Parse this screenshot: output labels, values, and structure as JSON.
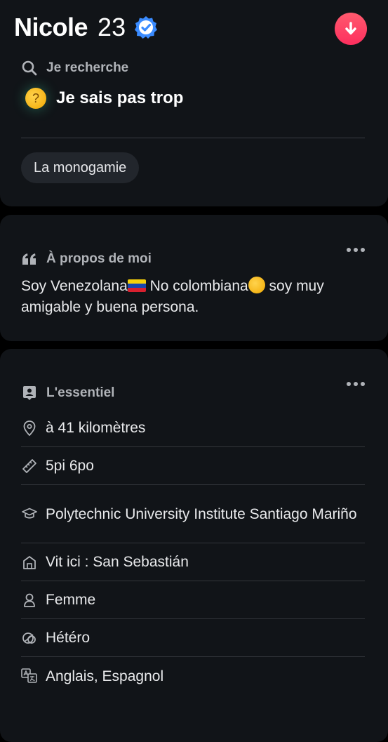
{
  "profile": {
    "name": "Nicole",
    "age": "23",
    "verified": true,
    "accent_color": "#3a8bff",
    "action_color": "#fd3a64"
  },
  "seeking": {
    "heading": "Je recherche",
    "emoji": "🤔",
    "value": "Je sais pas trop",
    "chip": "La monogamie"
  },
  "about": {
    "heading": "À propos de moi",
    "text_part1": "Soy Venezolana",
    "text_part2": " No colombiana",
    "text_part3": " soy muy amigable y buena persona."
  },
  "essentials": {
    "heading": "L'essentiel",
    "items": [
      {
        "icon": "location-pin-icon",
        "label": "à 41 kilomètres"
      },
      {
        "icon": "ruler-icon",
        "label": "5pi 6po"
      },
      {
        "icon": "graduation-cap-icon",
        "label": "Polytechnic University Institute Santiago Mariño"
      },
      {
        "icon": "home-icon",
        "label": "Vit ici : San Sebastián"
      },
      {
        "icon": "person-icon",
        "label": "Femme"
      },
      {
        "icon": "orientation-icon",
        "label": "Hétéro"
      },
      {
        "icon": "translate-icon",
        "label": "Anglais, Espagnol"
      }
    ]
  }
}
